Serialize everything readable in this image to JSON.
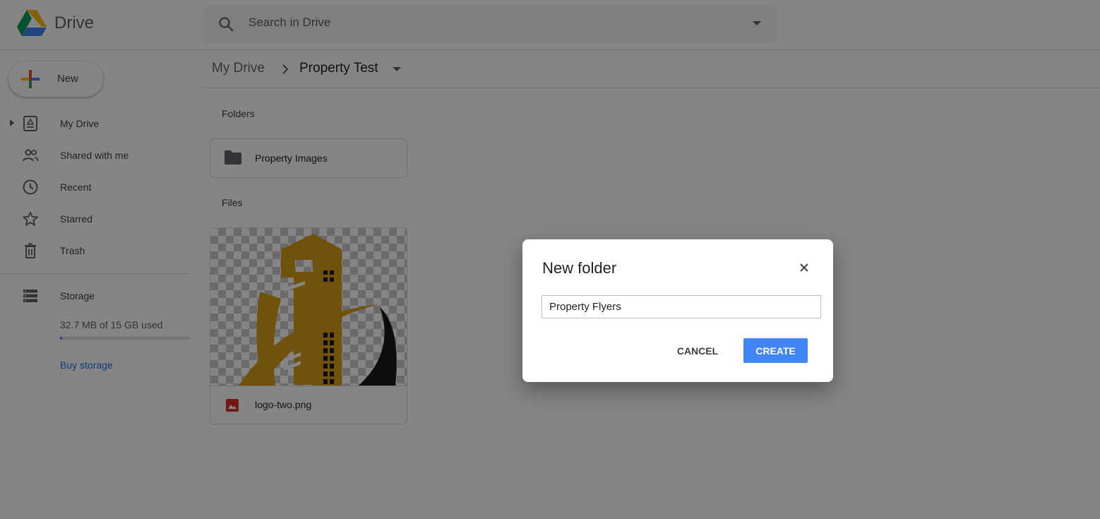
{
  "app": {
    "brand": "Drive"
  },
  "search": {
    "placeholder": "Search in Drive"
  },
  "sidebar": {
    "new_label": "New",
    "items": [
      {
        "label": "My Drive",
        "icon": "my-drive-icon"
      },
      {
        "label": "Shared with me",
        "icon": "people-icon"
      },
      {
        "label": "Recent",
        "icon": "clock-icon"
      },
      {
        "label": "Starred",
        "icon": "star-icon"
      },
      {
        "label": "Trash",
        "icon": "trash-icon"
      }
    ],
    "storage": {
      "label": "Storage",
      "used_text": "32.7 MB of 15 GB used",
      "used_fraction": 0.002,
      "buy_label": "Buy storage"
    }
  },
  "breadcrumb": {
    "root": "My Drive",
    "current": "Property Test"
  },
  "main": {
    "folders_title": "Folders",
    "folders": [
      {
        "name": "Property Images"
      }
    ],
    "files_title": "Files",
    "files": [
      {
        "name": "logo-two.png"
      }
    ]
  },
  "dialog": {
    "title": "New folder",
    "input_value": "Property Flyers",
    "cancel_label": "CANCEL",
    "create_label": "CREATE"
  },
  "colors": {
    "accent": "#4285f4",
    "link": "#1a73e8",
    "logo_gold": "#d89e1a",
    "overlay": "rgba(0,0,0,0.48)"
  }
}
